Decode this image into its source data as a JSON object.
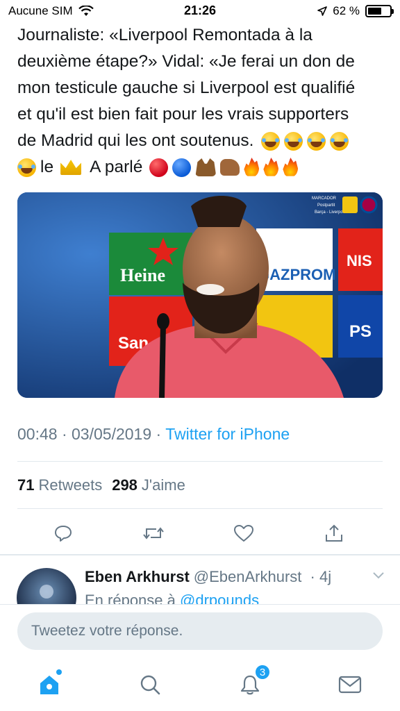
{
  "status_bar": {
    "carrier": "Aucune SIM",
    "time": "21:26",
    "battery": "62 %",
    "battery_level": 0.62
  },
  "tweet": {
    "lines": [
      "Journaliste: «Liverpool Remontada à la",
      "deuxième étape?» Vidal: «Je ferai un don de",
      "mon testicule gauche si Liverpool est qualifié",
      "et qu'il est bien fait pour les vrais supporters",
      "de Madrid qui les ont soutenus."
    ],
    "line6_word1": "le",
    "line6_word2": "A parlé",
    "media": {
      "corner_brand": "MARCADOR",
      "corner_line2": "Postpartit",
      "corner_line3": "Barça - Liverpool",
      "sponsor_1": "Heine",
      "sponsor_2": "GAZPROM",
      "sponsor_3": "NIS",
      "sponsor_4": "San"
    },
    "time": "00:48",
    "date": "03/05/2019",
    "separator": "·",
    "source": "Twitter for iPhone",
    "retweets_count": "71",
    "retweets_label": "Retweets",
    "likes_count": "298",
    "likes_label": "J'aime"
  },
  "actions": {
    "reply_icon": "reply-icon",
    "retweet_icon": "retweet-icon",
    "like_icon": "heart-icon",
    "share_icon": "share-icon"
  },
  "reply": {
    "name": "Eben Arkhurst",
    "handle": "@EbenArkhurst",
    "age": "· 4j",
    "in_reply_prefix": "En réponse à",
    "mention": "@drpounds"
  },
  "composer": {
    "placeholder": "Tweetez votre réponse."
  },
  "tabbar": {
    "notifications_badge": "3"
  },
  "colors": {
    "accent": "#1da1f2",
    "muted": "#657786",
    "text": "#14171a"
  }
}
